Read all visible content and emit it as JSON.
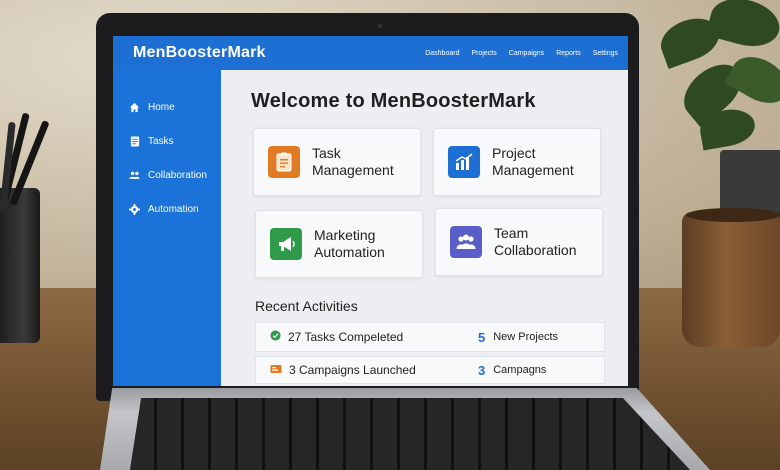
{
  "app": {
    "brand": "MenBoosterMark",
    "accent_color": "#1e6fd3"
  },
  "topnav": {
    "items": [
      "Dashboard",
      "Projects",
      "Campaigns",
      "Reports",
      "Settings"
    ]
  },
  "sidebar": {
    "items": [
      {
        "label": "Home",
        "icon": "home-icon"
      },
      {
        "label": "Tasks",
        "icon": "tasks-icon"
      },
      {
        "label": "Collaboration",
        "icon": "users-icon"
      },
      {
        "label": "Automation",
        "icon": "gear-icon"
      }
    ]
  },
  "main": {
    "title": "Welcome to MenBoosterMark",
    "cards": [
      {
        "label": "Task\nManagement",
        "icon": "clipboard-icon",
        "color": "#e07b24"
      },
      {
        "label": "Project\nManagement",
        "icon": "bar-chart-icon",
        "color": "#1e6fd3"
      },
      {
        "label": "Marketing\nAutomation",
        "icon": "megaphone-icon",
        "color": "#2e9a4a"
      },
      {
        "label": "Team\nCollaboration",
        "icon": "team-icon",
        "color": "#5a5fc8"
      }
    ],
    "recent": {
      "title": "Recent Activities",
      "rows": [
        {
          "left_text": "27 Tasks Compeleted",
          "left_icon": "check-circle-icon",
          "right_number": "5",
          "right_text": "New Projects"
        },
        {
          "left_text": "3 Campaigns Launched",
          "left_icon": "campaign-icon",
          "right_number": "3",
          "right_text": "Campagns"
        }
      ]
    }
  }
}
